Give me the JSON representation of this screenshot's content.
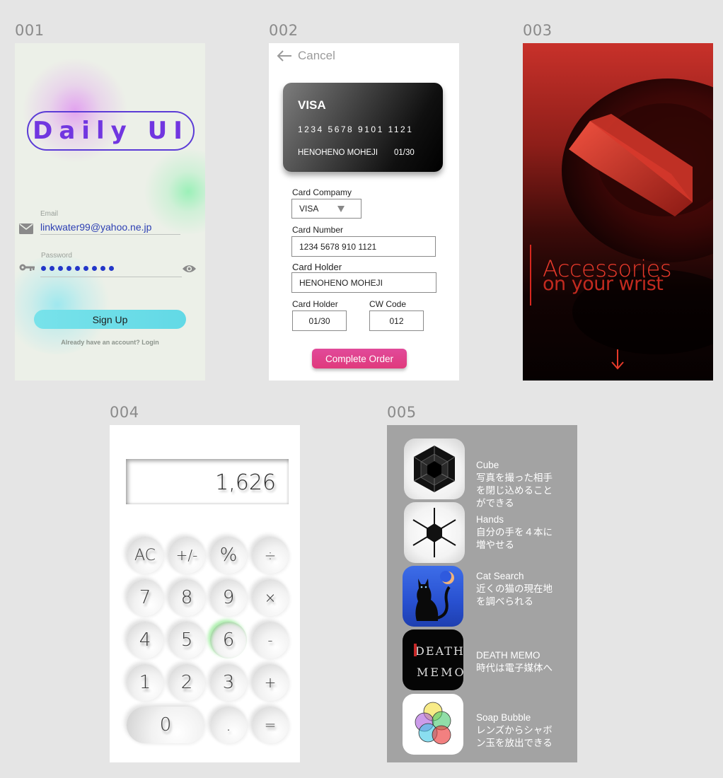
{
  "frames": [
    {
      "label": "001"
    },
    {
      "label": "002"
    },
    {
      "label": "003"
    },
    {
      "label": "004"
    },
    {
      "label": "005"
    }
  ],
  "signup": {
    "logo_text": "Daily UI",
    "email_label": "Email",
    "email_value": "linkwater99@yahoo.ne.jp",
    "password_label": "Password",
    "password_dots": 9,
    "signup_button": "Sign Up",
    "login_text": "Already have an account? Login",
    "colors": {
      "accent": "#6b3ae0",
      "button": "#6cdde8"
    }
  },
  "card_form": {
    "cancel": "Cancel",
    "card": {
      "brand": "VISA",
      "number": "1234 5678 9101 1121",
      "holder": "HENOHENO MOHEJI",
      "expiry": "01/30"
    },
    "company_label": "Card Compamy",
    "company_value": "VISA",
    "number_label": "Card Number",
    "number_value": "1234 5678 910 1121",
    "holder_label": "Card Holder",
    "holder_value": "HENOHENO MOHEJI",
    "expiry_label": "Card Holder",
    "expiry_value": "01/30",
    "cvc_label": "CW Code",
    "cvc_value": "012",
    "order_button": "Complete Order"
  },
  "accessories": {
    "title": "Accessories",
    "subtitle": "on your wrist",
    "arrow_icon": "arrow-down-icon",
    "colors": {
      "accent": "#e63a2a"
    }
  },
  "calculator": {
    "display": "1,626",
    "keys": [
      "AC",
      "+/-",
      "%",
      "÷",
      "7",
      "8",
      "9",
      "×",
      "4",
      "5",
      "6",
      "-",
      "1",
      "2",
      "3",
      "+",
      "0",
      ".",
      "="
    ],
    "active_key": "6"
  },
  "apps": [
    {
      "name": "Cube",
      "desc": "写真を撮った相手\nを閉じ込めること\nができる",
      "icon": "cube-icon"
    },
    {
      "name": "Hands",
      "desc": "自分の手を４本に\n増やせる",
      "icon": "hands-icon"
    },
    {
      "name": "Cat Search",
      "desc": "近くの猫の現在地\nを調べられる",
      "icon": "cat-icon"
    },
    {
      "name": "DEATH MEMO",
      "desc": "時代は電子媒体へ",
      "icon": "death-memo-icon",
      "icon_lines": [
        "DEATH",
        "MEMO"
      ]
    },
    {
      "name": "Soap Bubble",
      "desc": "レンズからシャボ\nン玉を放出できる",
      "icon": "soap-bubble-icon"
    }
  ]
}
